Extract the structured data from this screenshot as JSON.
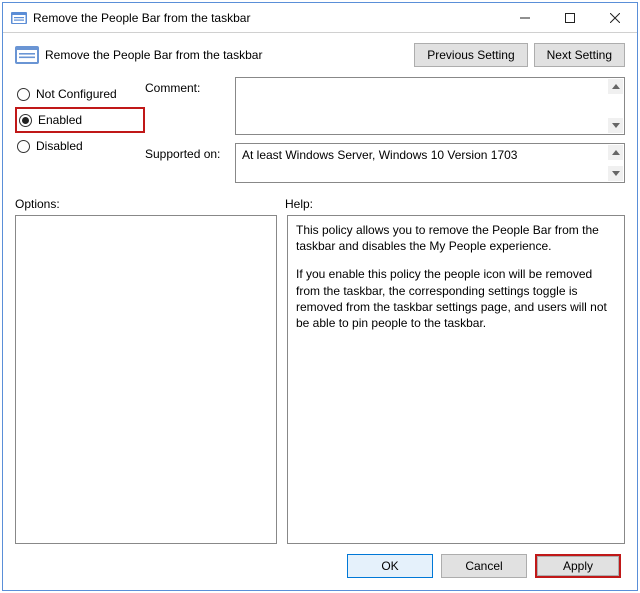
{
  "window": {
    "title": "Remove the People Bar from the taskbar"
  },
  "header": {
    "title": "Remove the People Bar from the taskbar",
    "previous_setting_label": "Previous Setting",
    "next_setting_label": "Next Setting"
  },
  "state_radios": {
    "not_configured": "Not Configured",
    "enabled": "Enabled",
    "disabled": "Disabled",
    "selected": "enabled"
  },
  "fields": {
    "comment_label": "Comment:",
    "comment_value": "",
    "supported_label": "Supported on:",
    "supported_value": "At least Windows Server, Windows 10 Version 1703"
  },
  "sections": {
    "options_label": "Options:",
    "help_label": "Help:"
  },
  "help": {
    "para1": "This policy allows you to remove the People Bar from the taskbar and disables the My People experience.",
    "para2": "If you enable this policy the people icon will be removed from the taskbar, the corresponding settings toggle is removed from the taskbar settings page, and users will not be able to pin people to the taskbar."
  },
  "footer": {
    "ok_label": "OK",
    "cancel_label": "Cancel",
    "apply_label": "Apply"
  }
}
